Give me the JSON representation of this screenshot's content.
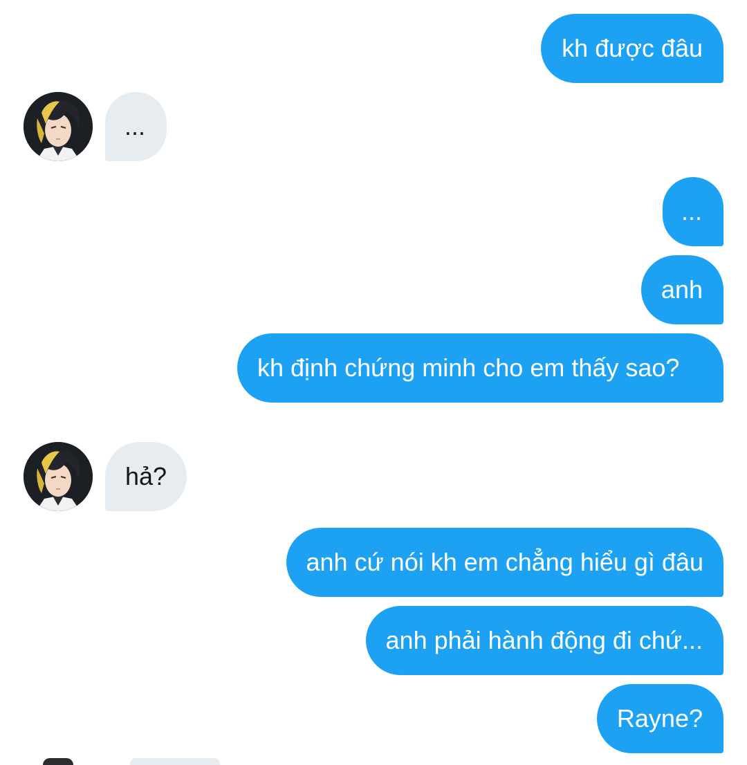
{
  "conversation": {
    "messages": [
      {
        "sender": "me",
        "text": "kh được đâu"
      },
      {
        "sender": "them",
        "text": "..."
      },
      {
        "sender": "me",
        "text": "..."
      },
      {
        "sender": "me",
        "text": "anh"
      },
      {
        "sender": "me",
        "text": "kh định chứng minh cho em thấy sao?"
      },
      {
        "sender": "them",
        "text": "hả?"
      },
      {
        "sender": "me",
        "text": "anh cứ nói kh em chẳng hiểu gì đâu"
      },
      {
        "sender": "me",
        "text": "anh phải hành động đi chứ..."
      },
      {
        "sender": "me",
        "text": "Rayne?"
      }
    ]
  },
  "colors": {
    "sent_bubble": "#1da1f2",
    "received_bubble": "#e6ecf0",
    "sent_text": "#ffffff",
    "received_text": "#14171a"
  },
  "icons": {
    "avatar": "contact-avatar"
  }
}
